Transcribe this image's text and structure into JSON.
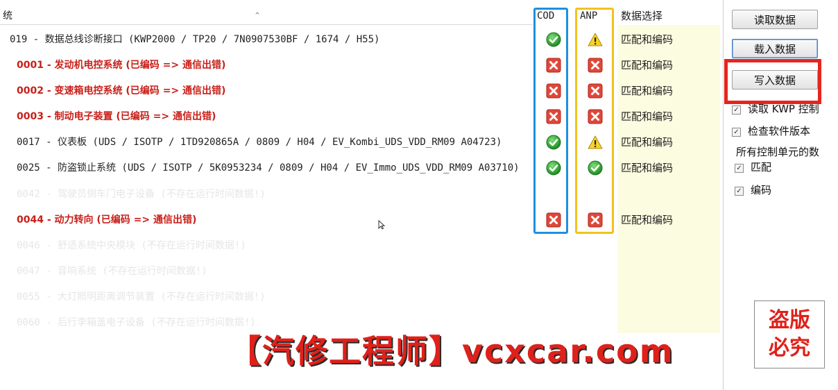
{
  "header": {
    "title_fragment": "统",
    "cod": "COD",
    "anp": "ANP",
    "data_select": "数据选择"
  },
  "rows": [
    {
      "label": "019 - 数据总线诊断接口  (KWP2000 / TP20 / 7N0907530BF / 1674 / H55)",
      "cod": "ok",
      "anp": "warn",
      "sel": "匹配和编码",
      "style": "top"
    },
    {
      "label": "0001 - 发动机电控系统  (已编码 => 通信出错)",
      "cod": "err",
      "anp": "err",
      "sel": "匹配和编码",
      "style": "err"
    },
    {
      "label": "0002 - 变速箱电控系统  (已编码 => 通信出错)",
      "cod": "err",
      "anp": "err",
      "sel": "匹配和编码",
      "style": "err"
    },
    {
      "label": "0003 - 制动电子装置  (已编码 => 通信出错)",
      "cod": "err",
      "anp": "err",
      "sel": "匹配和编码",
      "style": "err"
    },
    {
      "label": "0017 - 仪表板  (UDS / ISOTP / 1TD920865A / 0809 / H04 / EV_Kombi_UDS_VDD_RM09 A04723)",
      "cod": "ok",
      "anp": "warn",
      "sel": "匹配和编码",
      "style": "normal"
    },
    {
      "label": "0025 - 防盗锁止系统  (UDS / ISOTP / 5K0953234 / 0809 / H04 / EV_Immo_UDS_VDD_RM09 A03710)",
      "cod": "ok",
      "anp": "ok",
      "sel": "匹配和编码",
      "style": "normal"
    },
    {
      "label": "0042 - 驾驶员侧车门电子设备  (不存在运行时间数据!)",
      "cod": "",
      "anp": "",
      "sel": "",
      "style": "faded"
    },
    {
      "label": "0044 - 动力转向  (已编码 => 通信出错)",
      "cod": "err",
      "anp": "err",
      "sel": "匹配和编码",
      "style": "err"
    },
    {
      "label": "0046 - 舒适系统中央模块  (不存在运行时间数据!)",
      "cod": "",
      "anp": "",
      "sel": "",
      "style": "faded"
    },
    {
      "label": "0047 - 音响系统  (不存在运行时间数据!)",
      "cod": "",
      "anp": "",
      "sel": "",
      "style": "faded"
    },
    {
      "label": "0055 - 大灯照明距离调节装置  (不存在运行时间数据!)",
      "cod": "",
      "anp": "",
      "sel": "",
      "style": "faded"
    },
    {
      "label": "0060 - 后行李箱盖电子设备  (不存在运行时间数据!)",
      "cod": "",
      "anp": "",
      "sel": "",
      "style": "faded"
    }
  ],
  "sidebar": {
    "read_button": "读取数据",
    "load_button": "载入数据",
    "write_button": "写入数据",
    "chk_read_kwp": "读取 KWP 控制",
    "chk_check_version": "检查软件版本",
    "all_units_label": "所有控制单元的数",
    "chk_match": "匹配",
    "chk_code": "编码"
  },
  "stamp": {
    "line1": "盗版",
    "line2": "必究"
  },
  "watermark": "【汽修工程师】vcxcar.com",
  "colors": {
    "error_red": "#c8201a",
    "cod_box": "#1f8fe0",
    "anp_box": "#f2c21c",
    "highlight_red": "#e4261f"
  }
}
